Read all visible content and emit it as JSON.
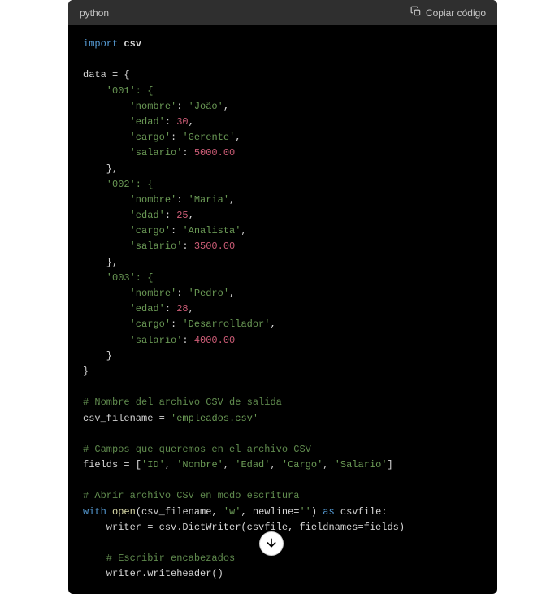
{
  "header": {
    "language": "python",
    "copy_label": "Copiar código"
  },
  "code": {
    "l01_import": "import",
    "l01_csv": " csv",
    "l03_data": "data = {",
    "l04": "    '001': {",
    "l05_key": "        'nombre'",
    "l05_val": "'João'",
    "l06_key": "        'edad'",
    "l06_val": "30",
    "l07_key": "        'cargo'",
    "l07_val": "'Gerente'",
    "l08_key": "        'salario'",
    "l08_val": "5000.00",
    "l09": "    },",
    "l10": "    '002': {",
    "l11_key": "        'nombre'",
    "l11_val": "'Maria'",
    "l12_key": "        'edad'",
    "l12_val": "25",
    "l13_key": "        'cargo'",
    "l13_val": "'Analista'",
    "l14_key": "        'salario'",
    "l14_val": "3500.00",
    "l15": "    },",
    "l16": "    '003': {",
    "l17_key": "        'nombre'",
    "l17_val": "'Pedro'",
    "l18_key": "        'edad'",
    "l18_val": "28",
    "l19_key": "        'cargo'",
    "l19_val": "'Desarrollador'",
    "l20_key": "        'salario'",
    "l20_val": "4000.00",
    "l21": "    }",
    "l22": "}",
    "l24_com": "# Nombre del archivo CSV de salida",
    "l25_var": "csv_filename = ",
    "l25_val": "'empleados.csv'",
    "l27_com": "# Campos que queremos en el archivo CSV",
    "l28_var": "fields = [",
    "l28_s1": "'ID'",
    "l28_s2": "'Nombre'",
    "l28_s3": "'Edad'",
    "l28_s4": "'Cargo'",
    "l28_s5": "'Salario'",
    "l28_end": "]",
    "l30_com": "# Abrir archivo CSV en modo escritura",
    "l31_with": "with",
    "l31_open": " open",
    "l31_p1": "(csv_filename, ",
    "l31_w": "'w'",
    "l31_p2": ", newline=",
    "l31_empty": "''",
    "l31_p3": ") ",
    "l31_as": "as",
    "l31_p4": " csvfile:",
    "l32_p1": "    writer = csv.DictWriter(csvfile, fieldnames=fields)",
    "l34_com": "    # Escribir encabezados",
    "l35": "    writer.writeheader()"
  }
}
